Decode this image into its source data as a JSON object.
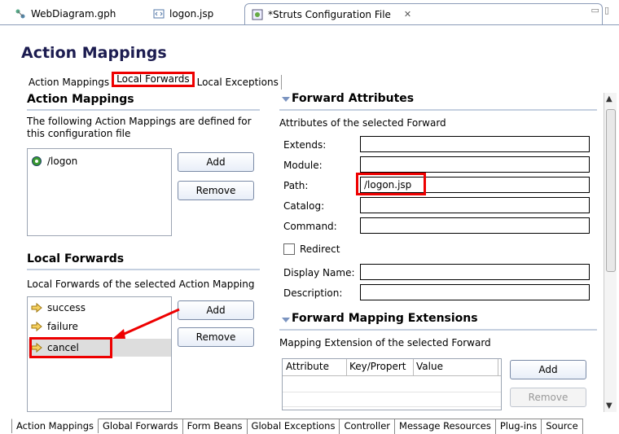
{
  "editor_tabs": [
    {
      "label": "WebDiagram.gph",
      "icon": "diagram-icon"
    },
    {
      "label": "logon.jsp",
      "icon": "jsp-file-icon"
    },
    {
      "label": "*Struts Configuration File",
      "icon": "struts-config-icon",
      "close": "✕"
    }
  ],
  "page_title": "Action Mappings",
  "sub_tabs": [
    "Action Mappings",
    "Local Forwards",
    "Local Exceptions"
  ],
  "action_mappings": {
    "title": "Action Mappings",
    "description": "The following Action Mappings are defined for this configuration file",
    "items": [
      "/logon"
    ],
    "add_label": "Add",
    "remove_label": "Remove"
  },
  "local_forwards": {
    "title": "Local Forwards",
    "description": "Local Forwards of the selected Action Mapping",
    "items": [
      "success",
      "failure",
      "cancel"
    ],
    "add_label": "Add",
    "remove_label": "Remove"
  },
  "forward_attributes": {
    "title": "Forward Attributes",
    "description": "Attributes of the selected Forward",
    "labels": {
      "extends": "Extends:",
      "module": "Module:",
      "path": "Path:",
      "catalog": "Catalog:",
      "command": "Command:",
      "redirect": "Redirect",
      "display_name": "Display Name:",
      "description": "Description:"
    },
    "values": {
      "extends": "",
      "module": "",
      "path": "/logon.jsp",
      "catalog": "",
      "command": "",
      "display_name": "",
      "description": ""
    },
    "redirect_checked": false
  },
  "forward_mapping_extensions": {
    "title": "Forward Mapping Extensions",
    "description": "Mapping Extension of the selected Forward",
    "columns": [
      "Attribute",
      "Key/Propert",
      "Value"
    ],
    "add_label": "Add",
    "remove_label": "Remove"
  },
  "bottom_tabs": [
    "Action Mappings",
    "Global Forwards",
    "Form Beans",
    "Global Exceptions",
    "Controller",
    "Message Resources",
    "Plug-ins",
    "Source"
  ],
  "colors": {
    "highlight": "#e00000",
    "title": "#1c1c50",
    "section_rule": "#c5d0e0"
  }
}
